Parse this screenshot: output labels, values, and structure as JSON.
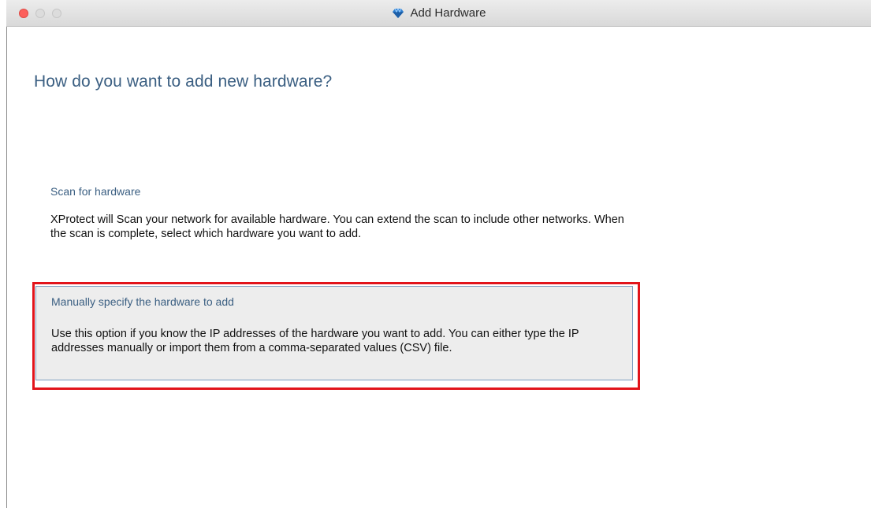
{
  "window": {
    "title": "Add Hardware",
    "icon": "diamond-app-icon"
  },
  "page": {
    "heading": "How do you want to add new hardware?"
  },
  "options": [
    {
      "title": "Scan for hardware",
      "description": "XProtect will Scan your network for available hardware. You can extend the scan to include other networks. When the scan is complete, select which hardware you want to add.",
      "selected": false
    },
    {
      "title": "Manually specify the hardware to add",
      "description": "Use this option if you know the IP addresses of the hardware you want to add. You can either type the IP addresses manually or import them from a comma-separated values (CSV) file.",
      "selected": true
    }
  ],
  "colors": {
    "accent_text": "#3b5f82",
    "highlight": "#e2141b",
    "selected_bg": "#ededed"
  }
}
